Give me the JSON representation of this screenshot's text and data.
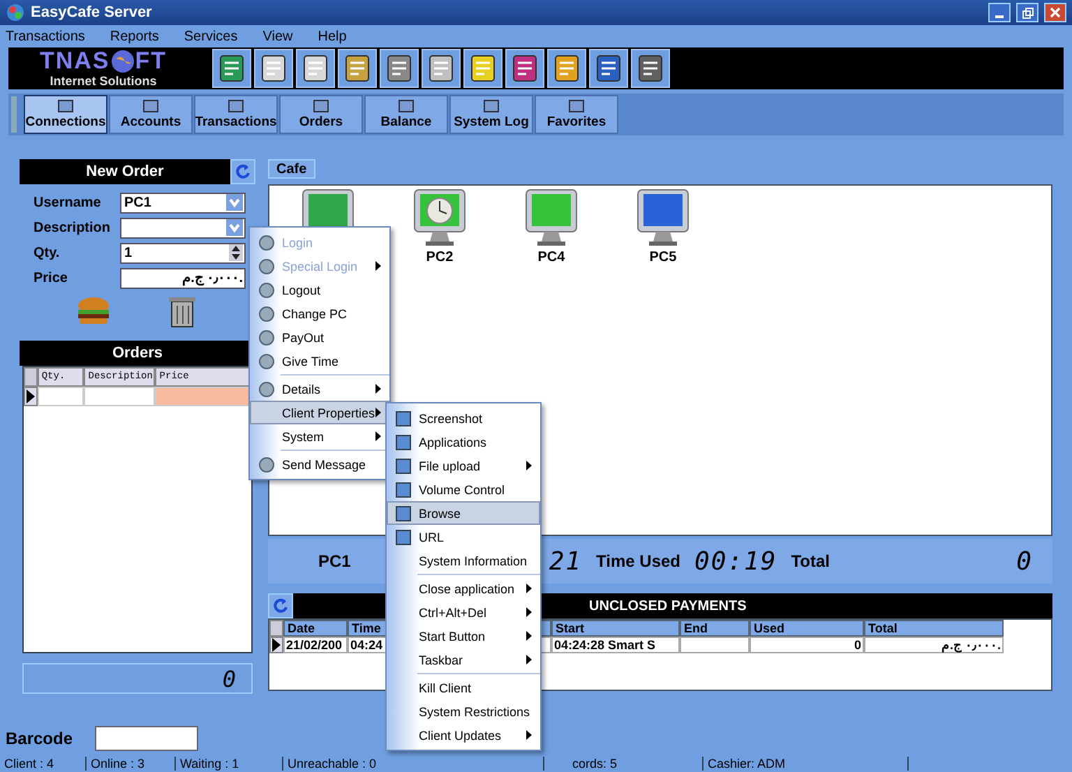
{
  "window": {
    "title": "EasyCafe Server"
  },
  "menu_bar": [
    "Transactions",
    "Reports",
    "Services",
    "View",
    "Help"
  ],
  "logo": {
    "word_start": "TNAS",
    "word_end": "FT",
    "tagline": "Internet Solutions"
  },
  "tabs": [
    {
      "label": "Connections",
      "selected": true
    },
    {
      "label": "Accounts",
      "selected": false
    },
    {
      "label": "Transactions",
      "selected": false
    },
    {
      "label": "Orders",
      "selected": false
    },
    {
      "label": "Balance",
      "selected": false
    },
    {
      "label": "System Log",
      "selected": false
    },
    {
      "label": "Favorites",
      "selected": false
    }
  ],
  "new_order": {
    "title": "New Order",
    "fields": [
      {
        "label": "Username",
        "value": "PC1",
        "kind": "dropdown"
      },
      {
        "label": "Description",
        "kind": "dropdown"
      },
      {
        "label": "Qty.",
        "value": "1",
        "kind": "spinner"
      },
      {
        "label": "Price",
        "value": "٠٫٠٠٠ ج.م.",
        "kind": "text"
      }
    ]
  },
  "orders": {
    "title": "Orders",
    "columns": [
      "Qty.",
      "Description",
      "Price"
    ],
    "total": "0"
  },
  "barcode": {
    "label": "Barcode"
  },
  "cafe_tab": "Cafe",
  "computers": [
    {
      "color": "#2fa84a",
      "clock": false
    },
    {
      "label": "PC2",
      "color": "#36c23a",
      "clock": true
    },
    {
      "label": "PC4",
      "color": "#36c23a",
      "clock": false
    },
    {
      "label": "PC5",
      "color": "#2a62d8",
      "clock": false
    }
  ],
  "details": {
    "name": "PC1",
    "start": "21",
    "used_label": "Time Used",
    "used": "00:19",
    "total_label": "Total",
    "total": "0"
  },
  "payments": {
    "title": "UNCLOSED PAYMENTS",
    "columns": [
      "Date",
      "Time",
      "Start",
      "End",
      "Used",
      "Total"
    ],
    "rows": [
      [
        "21/02/200",
        "04:24",
        "04:24:28 Smart S",
        "",
        "0",
        "٠٫٠٠٠ ج.م."
      ]
    ]
  },
  "status_bar": [
    "Client : 4",
    "Online : 3",
    "Waiting : 1",
    "Unreachable : 0",
    "cords: 5",
    "Cashier: ADM"
  ],
  "context_menu": [
    {
      "kind": "item",
      "label": "Login",
      "disabled": true,
      "submenu": false,
      "selected": false
    },
    {
      "kind": "item",
      "label": "Special Login",
      "disabled": true,
      "submenu": true,
      "selected": false
    },
    {
      "kind": "item",
      "label": "Logout",
      "disabled": false,
      "submenu": false,
      "selected": false
    },
    {
      "kind": "item",
      "label": "Change PC",
      "disabled": false,
      "submenu": false,
      "selected": false
    },
    {
      "kind": "item",
      "label": "PayOut",
      "disabled": false,
      "submenu": false,
      "selected": false
    },
    {
      "kind": "item",
      "label": "Give Time",
      "disabled": false,
      "submenu": false,
      "selected": false
    },
    {
      "kind": "separator"
    },
    {
      "kind": "item",
      "label": "Details",
      "disabled": false,
      "submenu": true,
      "selected": false
    },
    {
      "kind": "item",
      "label": "Client Properties",
      "disabled": false,
      "submenu": true,
      "selected": true
    },
    {
      "kind": "item",
      "label": "System",
      "disabled": false,
      "submenu": true,
      "selected": false
    },
    {
      "kind": "separator"
    },
    {
      "kind": "item",
      "label": "Send Message",
      "disabled": false,
      "submenu": false,
      "selected": false
    }
  ],
  "submenu": [
    {
      "kind": "item",
      "label": "Screenshot",
      "submenu": false,
      "selected": false
    },
    {
      "kind": "item",
      "label": "Applications",
      "submenu": false,
      "selected": false
    },
    {
      "kind": "item",
      "label": "File upload",
      "submenu": true,
      "selected": false
    },
    {
      "kind": "item",
      "label": "Volume Control",
      "submenu": false,
      "selected": false
    },
    {
      "kind": "item",
      "label": "Browse",
      "submenu": false,
      "selected": true
    },
    {
      "kind": "item",
      "label": "URL",
      "submenu": false,
      "selected": false
    },
    {
      "kind": "item",
      "label": "System Information",
      "submenu": false,
      "selected": false
    },
    {
      "kind": "separator"
    },
    {
      "kind": "item",
      "label": "Close application",
      "submenu": true,
      "selected": false
    },
    {
      "kind": "item",
      "label": "Ctrl+Alt+Del",
      "submenu": true,
      "selected": false
    },
    {
      "kind": "item",
      "label": "Start Button",
      "submenu": true,
      "selected": false
    },
    {
      "kind": "item",
      "label": "Taskbar",
      "submenu": true,
      "selected": false
    },
    {
      "kind": "separator"
    },
    {
      "kind": "item",
      "label": "Kill Client",
      "submenu": false,
      "selected": false
    },
    {
      "kind": "item",
      "label": "System Restrictions",
      "submenu": false,
      "selected": false
    },
    {
      "kind": "item",
      "label": "Client Updates",
      "submenu": true,
      "selected": false
    }
  ]
}
